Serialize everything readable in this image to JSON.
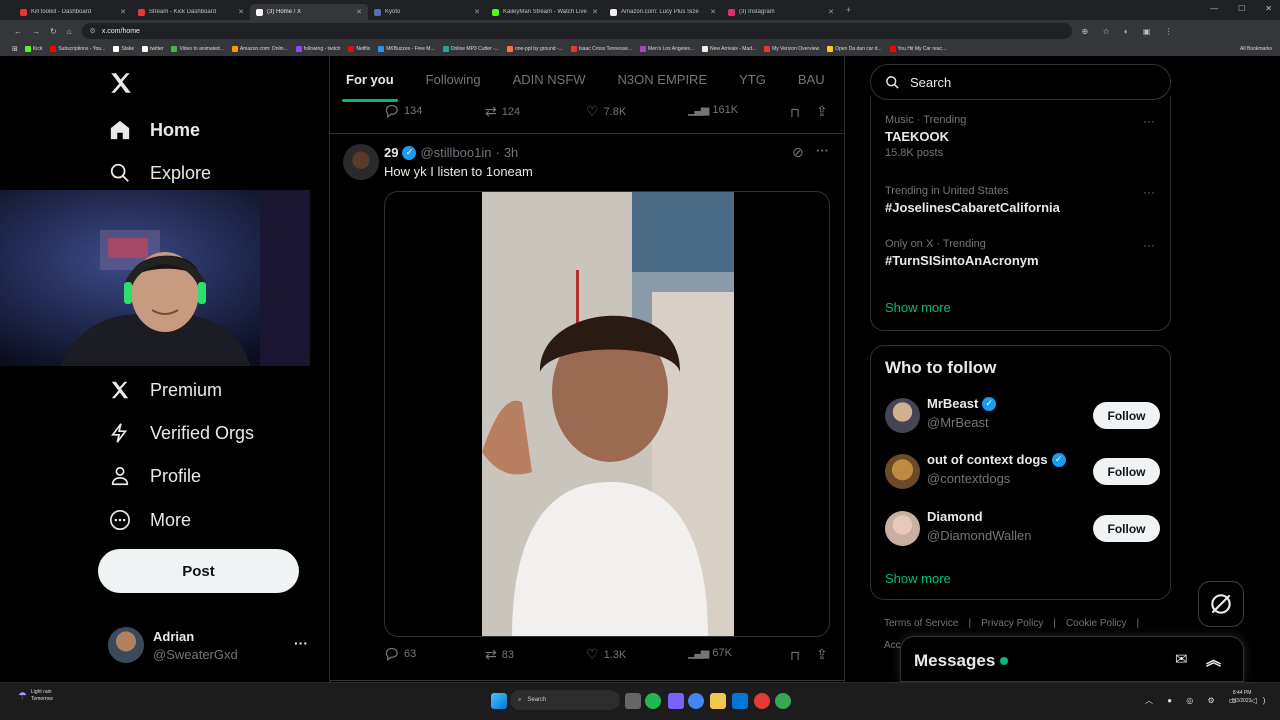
{
  "browser": {
    "tabs": [
      {
        "label": "Kill toolkit - Dashboard",
        "color": "#e53935",
        "active": false
      },
      {
        "label": "Stream - Kick Dashboard",
        "color": "#e53935",
        "active": false
      },
      {
        "label": "(3) Home / X",
        "color": "#ffffff",
        "active": true
      },
      {
        "label": "Kyoto",
        "color": "#5c6bc0",
        "active": false
      },
      {
        "label": "KaileyMan Stream - Watch Live",
        "color": "#53fc18",
        "active": false
      },
      {
        "label": "Amazon.com: Lucy Plus Size",
        "color": "#eeeeee",
        "active": false
      },
      {
        "label": "(3) Instagram",
        "color": "#e1306c",
        "active": false
      }
    ],
    "url": "x.com/home",
    "bookmarks": [
      {
        "label": "Kick",
        "color": "#53fc18"
      },
      {
        "label": "Subscriptions - You...",
        "color": "#ff0000"
      },
      {
        "label": "Stake",
        "color": "#ffffff"
      },
      {
        "label": "twitter",
        "color": "#ffffff"
      },
      {
        "label": "Video to animated...",
        "color": "#4caf50"
      },
      {
        "label": "Amazon.com: Onlin...",
        "color": "#ff9900"
      },
      {
        "label": "following - twitch",
        "color": "#9146ff"
      },
      {
        "label": "Netflix",
        "color": "#e50914"
      },
      {
        "label": "MKBuzzes - Free M...",
        "color": "#2196f3"
      },
      {
        "label": "Online MP3 Cutter -...",
        "color": "#26a69a"
      },
      {
        "label": "one-ppt by ground -...",
        "color": "#ff7043"
      },
      {
        "label": "Isaac Cross Tennesse...",
        "color": "#e53935"
      },
      {
        "label": "Men's Los Angeles...",
        "color": "#ab47bc"
      },
      {
        "label": "New Arrivals - Mad...",
        "color": "#eeeeee"
      },
      {
        "label": "My Verizon Overview",
        "color": "#e53935"
      },
      {
        "label": "Open Da dan car d...",
        "color": "#ffca28"
      },
      {
        "label": "You Hit My Car reac...",
        "color": "#ff0000"
      }
    ],
    "all_bookmarks": "All Bookmarks"
  },
  "nav": {
    "home": "Home",
    "explore": "Explore",
    "premium": "Premium",
    "verified_orgs": "Verified Orgs",
    "profile": "Profile",
    "more": "More",
    "post": "Post",
    "account_name": "Adrian",
    "account_handle": "@SweaterGxd"
  },
  "feed": {
    "tabs": [
      "For you",
      "Following",
      "ADIN NSFW",
      "N3ON EMPIRE",
      "YTG",
      "BAU"
    ],
    "prev_tweet_actions": {
      "replies": "134",
      "reposts": "124",
      "likes": "7.8K",
      "views": "161K"
    },
    "tweet": {
      "author": "29",
      "handle": "@stillboo1in",
      "time": "3h",
      "dot": "·",
      "text": "How yk I listen to 1oneam",
      "replies": "63",
      "reposts": "83",
      "likes": "1.3K",
      "views": "67K"
    }
  },
  "sidebar": {
    "search_placeholder": "Search",
    "trends": [
      {
        "meta": "Music · Trending",
        "name": "TAEKOOK",
        "posts": "15.8K posts"
      },
      {
        "meta": "Trending in United States",
        "name": "#JoselinesCabaretCalifornia",
        "posts": ""
      },
      {
        "meta": "Only on X · Trending",
        "name": "#TurnSISintoAnAcronym",
        "posts": ""
      }
    ],
    "show_more": "Show more",
    "who_to_follow_title": "Who to follow",
    "who_to_follow": [
      {
        "name": "MrBeast",
        "handle": "@MrBeast",
        "verified": true,
        "button": "Follow"
      },
      {
        "name": "out of context dogs",
        "handle": "@contextdogs",
        "verified": true,
        "button": "Follow"
      },
      {
        "name": "Diamond",
        "handle": "@DiamondWallen",
        "verified": false,
        "button": "Follow"
      }
    ],
    "show_more_2": "Show more",
    "footer": [
      "Terms of Service",
      "Privacy Policy",
      "Cookie Policy",
      "Acc"
    ],
    "footer_sep": "|",
    "messages": "Messages"
  },
  "taskbar": {
    "weather": "Light rain",
    "weather_sub": "Tomorrow",
    "search": "Search",
    "time": "8:44 PM",
    "date": "8/3/2023"
  },
  "colors": {
    "accent": "#00ba7c",
    "verified": "#1d9bf0",
    "online_dot": "#00ba7c"
  }
}
